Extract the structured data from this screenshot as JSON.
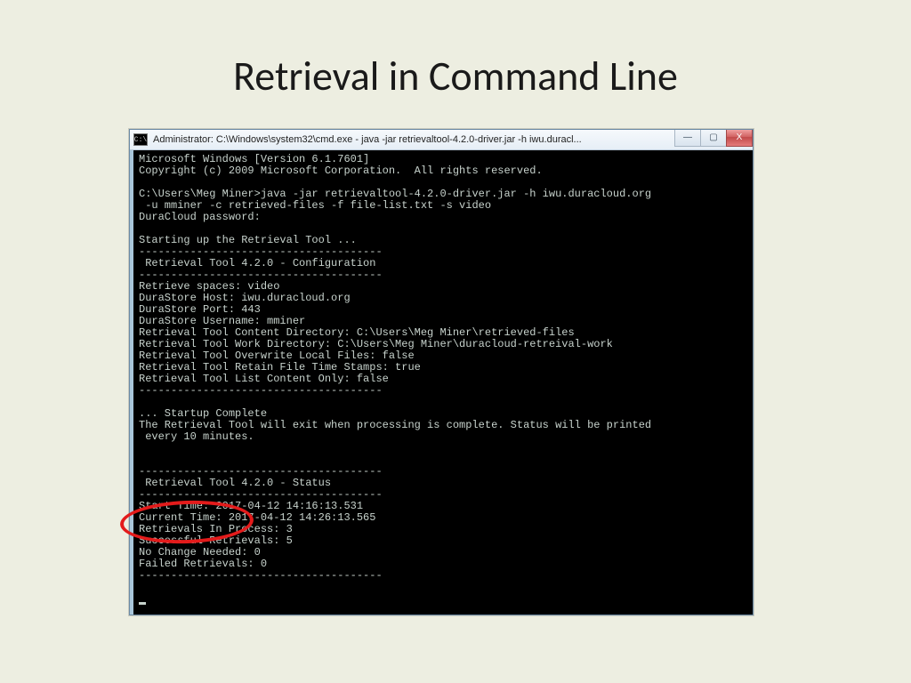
{
  "slide": {
    "title": "Retrieval in Command Line"
  },
  "window": {
    "icon_text": "C:\\",
    "title": "Administrator: C:\\Windows\\system32\\cmd.exe - java  -jar retrievaltool-4.2.0-driver.jar -h iwu.duracl...",
    "controls": {
      "min": "—",
      "max": "▢",
      "close": "X"
    }
  },
  "terminal": {
    "lines": [
      "Microsoft Windows [Version 6.1.7601]",
      "Copyright (c) 2009 Microsoft Corporation.  All rights reserved.",
      "",
      "C:\\Users\\Meg Miner>java -jar retrievaltool-4.2.0-driver.jar -h iwu.duracloud.org",
      " -u mminer -c retrieved-files -f file-list.txt -s video",
      "DuraCloud password:",
      "",
      "Starting up the Retrieval Tool ...",
      "--------------------------------------",
      " Retrieval Tool 4.2.0 - Configuration",
      "--------------------------------------",
      "Retrieve spaces: video",
      "DuraStore Host: iwu.duracloud.org",
      "DuraStore Port: 443",
      "DuraStore Username: mminer",
      "Retrieval Tool Content Directory: C:\\Users\\Meg Miner\\retrieved-files",
      "Retrieval Tool Work Directory: C:\\Users\\Meg Miner\\duracloud-retreival-work",
      "Retrieval Tool Overwrite Local Files: false",
      "Retrieval Tool Retain File Time Stamps: true",
      "Retrieval Tool List Content Only: false",
      "--------------------------------------",
      "",
      "... Startup Complete",
      "The Retrieval Tool will exit when processing is complete. Status will be printed",
      " every 10 minutes.",
      "",
      "",
      "--------------------------------------",
      " Retrieval Tool 4.2.0 - Status",
      "--------------------------------------",
      "Start Time: 2017-04-12 14:16:13.531",
      "Current Time: 2017-04-12 14:26:13.565",
      "Retrievals In Process: 3",
      "Successful Retrievals: 5",
      "No Change Needed: 0",
      "Failed Retrievals: 0",
      "--------------------------------------",
      ""
    ]
  }
}
